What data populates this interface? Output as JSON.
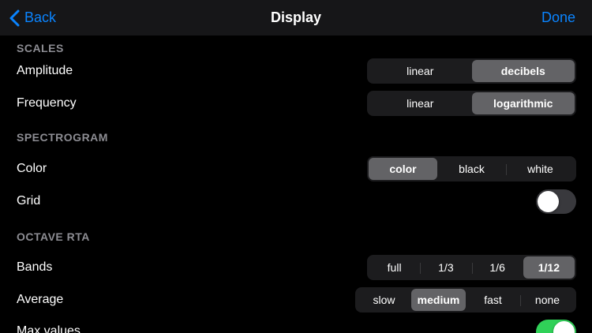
{
  "nav": {
    "back_label": "Back",
    "title": "Display",
    "done_label": "Done",
    "accent_color": "#0a84ff"
  },
  "sections": {
    "scales": "SCALES",
    "spectrogram": "SPECTROGRAM",
    "octave_rta": "OCTAVE RTA"
  },
  "rows": {
    "amplitude": {
      "label": "Amplitude",
      "options": [
        "linear",
        "decibels"
      ],
      "selected": "decibels"
    },
    "frequency": {
      "label": "Frequency",
      "options": [
        "linear",
        "logarithmic"
      ],
      "selected": "logarithmic"
    },
    "color": {
      "label": "Color",
      "options": [
        "color",
        "black",
        "white"
      ],
      "selected": "color"
    },
    "grid": {
      "label": "Grid",
      "on": false
    },
    "bands": {
      "label": "Bands",
      "options": [
        "full",
        "1/3",
        "1/6",
        "1/12"
      ],
      "selected": "1/12"
    },
    "average": {
      "label": "Average",
      "options": [
        "slow",
        "medium",
        "fast",
        "none"
      ],
      "selected": "medium"
    },
    "max_values": {
      "label": "Max values",
      "on": true
    }
  },
  "colors": {
    "toggle_on": "#30d158",
    "toggle_off": "#39393d",
    "segment_selected": "#636366"
  }
}
